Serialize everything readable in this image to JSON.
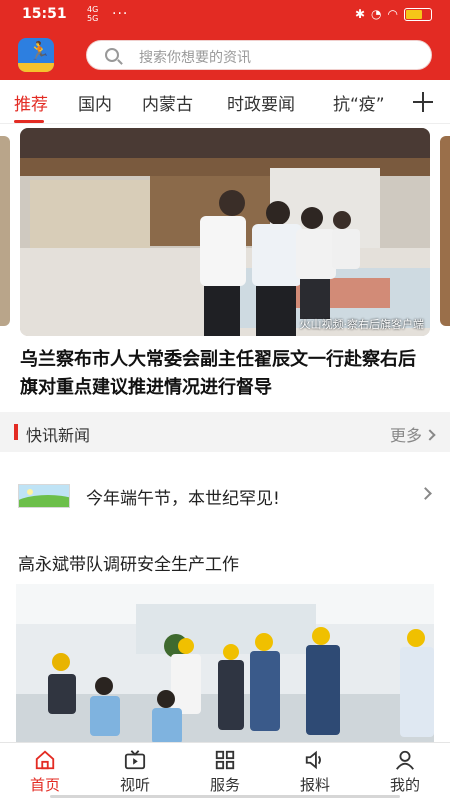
{
  "statusbar": {
    "time": "15:51",
    "network_label": "4G 5G",
    "dots": "···"
  },
  "search": {
    "placeholder": "搜索你想要的资讯"
  },
  "tabs": [
    {
      "label": "推荐",
      "active": true
    },
    {
      "label": "国内",
      "active": false
    },
    {
      "label": "内蒙古",
      "active": false
    },
    {
      "label": "时政要闻",
      "active": false
    },
    {
      "label": "抗“疫”",
      "active": false
    }
  ],
  "banner": {
    "watermark": "火山视频·察右后旗客户端",
    "headline": "乌兰察布市人大常委会副主任翟辰文一行赴察右后旗对重点建议推进情况进行督导"
  },
  "flash_news": {
    "section_title": "快讯新闻",
    "more_label": "更多",
    "item_text": "今年端午节，本世纪罕见!"
  },
  "article": {
    "title": "高永斌带队调研安全生产工作"
  },
  "bottom_nav": [
    {
      "label": "首页",
      "icon": "home-icon",
      "active": true
    },
    {
      "label": "视听",
      "icon": "video-icon",
      "active": false
    },
    {
      "label": "服务",
      "icon": "grid-icon",
      "active": false
    },
    {
      "label": "报料",
      "icon": "speaker-icon",
      "active": false
    },
    {
      "label": "我的",
      "icon": "user-icon",
      "active": false
    }
  ],
  "colors": {
    "brand_red": "#e32b23",
    "tab_active": "#e32b23",
    "section_bg": "#f3f3f3"
  }
}
